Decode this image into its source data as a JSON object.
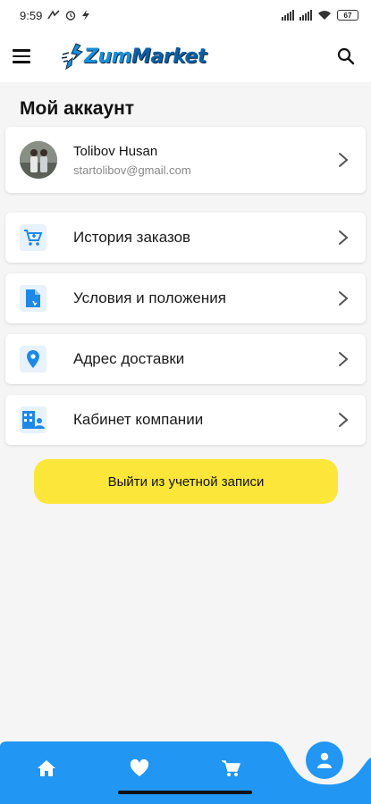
{
  "status_bar": {
    "time": "9:59",
    "battery": "67"
  },
  "header": {
    "logo_text_part1": "Zum",
    "logo_text_part2": "Market"
  },
  "page": {
    "title": "Мой аккаунт"
  },
  "profile": {
    "name": "Tolibov Husan",
    "email": "startolibov@gmail.com"
  },
  "menu": {
    "items": [
      {
        "label": "История заказов",
        "icon": "cart-icon"
      },
      {
        "label": "Условия и положения",
        "icon": "document-icon"
      },
      {
        "label": "Адрес доставки",
        "icon": "location-pin-icon"
      },
      {
        "label": "Кабинет компании",
        "icon": "company-icon"
      }
    ]
  },
  "logout": {
    "label": "Выйти из учетной записи"
  },
  "bottom_nav": {
    "items": [
      "home-icon",
      "heart-icon",
      "cart-icon",
      "profile-icon"
    ],
    "active": "profile-icon"
  },
  "colors": {
    "accent": "#2196f3",
    "logout_button": "#fde63a",
    "icon_bg": "#e7f2fc"
  }
}
